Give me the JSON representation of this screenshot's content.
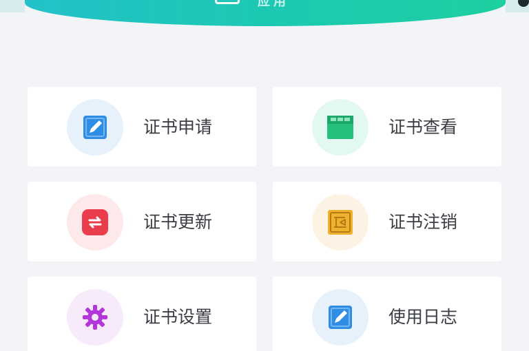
{
  "header": {
    "title": "应用"
  },
  "menu": {
    "items": [
      {
        "label": "证书申请",
        "icon": "edit-certificate-icon",
        "bg": "#e6f1fc",
        "accent": "#2e8ee6"
      },
      {
        "label": "证书查看",
        "icon": "view-certificate-icon",
        "bg": "#e3f8f0",
        "accent": "#25c17a"
      },
      {
        "label": "证书更新",
        "icon": "refresh-certificate-icon",
        "bg": "#fde9ea",
        "accent": "#ea3d4b"
      },
      {
        "label": "证书注销",
        "icon": "cancel-certificate-icon",
        "bg": "#fdf3e5",
        "accent": "#f0b12d"
      },
      {
        "label": "证书设置",
        "icon": "settings-gear-icon",
        "bg": "#f7ebfb",
        "accent": "#b236d8"
      },
      {
        "label": "使用日志",
        "icon": "usage-log-icon",
        "bg": "#e6f1fc",
        "accent": "#2e8ee6"
      }
    ]
  }
}
